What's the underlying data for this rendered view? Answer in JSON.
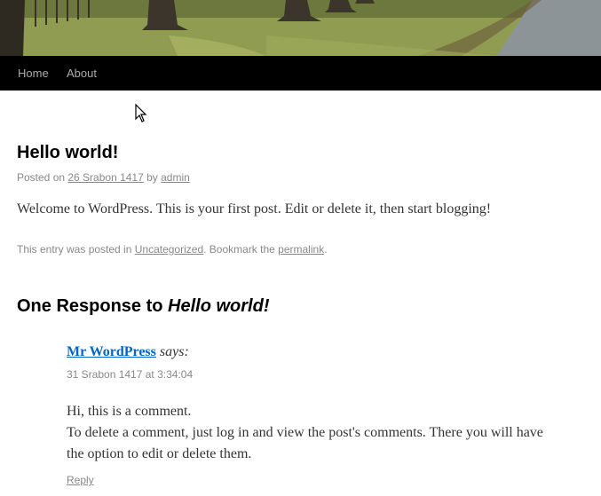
{
  "nav": {
    "home": "Home",
    "about": "About"
  },
  "post": {
    "title": "Hello world!",
    "meta_prefix": "Posted on ",
    "date": "26 Srabon 1417",
    "meta_by": " by ",
    "author": "admin",
    "content": "Welcome to WordPress. This is your first post. Edit or delete it, then start blogging!",
    "utility_prefix": "This entry was posted in ",
    "category": "Uncategorized",
    "utility_mid": ". Bookmark the ",
    "permalink": "permalink",
    "utility_end": "."
  },
  "comments": {
    "title_prefix": "One Response to ",
    "title_post": "Hello world!",
    "comment": {
      "author": "Mr WordPress",
      "says": "says:",
      "date": "31 Srabon 1417 at 3:34:04",
      "line1": "Hi, this is a comment.",
      "line2": "To delete a comment, just log in and view the post's comments. There you will have the option to edit or delete them.",
      "reply": "Reply"
    }
  }
}
